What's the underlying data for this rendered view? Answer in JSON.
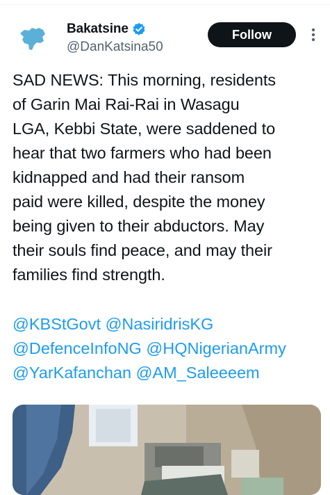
{
  "author": {
    "display_name": "Bakatsine",
    "handle": "@DanKatsina50",
    "verified": true,
    "avatar_icon": "map-silhouette-avatar",
    "avatar_color": "#5bb0d8"
  },
  "actions": {
    "follow_label": "Follow",
    "more_icon": "more-vertical-icon"
  },
  "tweet": {
    "lines": [
      "SAD NEWS: This morning, residents",
      "of Garin Mai Rai-Rai in Wasagu",
      "LGA, Kebbi State, were saddened to",
      "hear that two farmers who had been",
      "kidnapped and had their ransom",
      "paid were killed, despite the money",
      "being given to their abductors. May",
      "their souls find peace, and may their",
      "families find strength."
    ],
    "mention_lines": [
      [
        "@KBStGovt",
        "@NasiridrisKG"
      ],
      [
        "@DefenceInfoNG",
        "@HQNigerianArmy"
      ],
      [
        "@YarKafanchan",
        "@AM_Saleeeem"
      ]
    ]
  },
  "colors": {
    "text": "#0f1419",
    "secondary": "#536471",
    "link": "#1d9bf0",
    "verified": "#1d9bf0",
    "button_bg": "#0f1419"
  }
}
